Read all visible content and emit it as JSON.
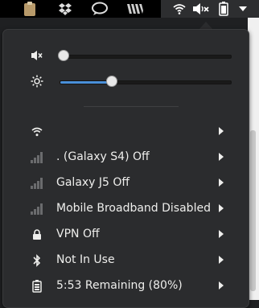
{
  "panel": {
    "icons": [
      "clipboard-icon",
      "dropbox-icon",
      "chat-bubble-icon",
      "window-list-icon",
      "wifi-icon",
      "volume-muted-icon",
      "battery-icon",
      "dropdown-arrow-icon"
    ]
  },
  "sliders": {
    "volume": {
      "icon": "volume-muted-icon",
      "level": 0.02
    },
    "brightness": {
      "icon": "brightness-icon",
      "level": 0.3
    }
  },
  "menu": {
    "items": [
      {
        "icon": "wifi-icon",
        "label": ""
      },
      {
        "icon": "signal-bars-icon",
        "label": ". (Galaxy S4) Off"
      },
      {
        "icon": "signal-bars-icon",
        "label": "Galaxy J5 Off"
      },
      {
        "icon": "signal-bars-icon",
        "label": "Mobile Broadband Disabled"
      },
      {
        "icon": "vpn-lock-icon",
        "label": "VPN Off"
      },
      {
        "icon": "bluetooth-icon",
        "label": "Not In Use"
      },
      {
        "icon": "battery-icon",
        "label": "5:53 Remaining (80%)"
      }
    ]
  },
  "colors": {
    "accent": "#4a90d9",
    "menu_bg": "#2b2c2e"
  }
}
